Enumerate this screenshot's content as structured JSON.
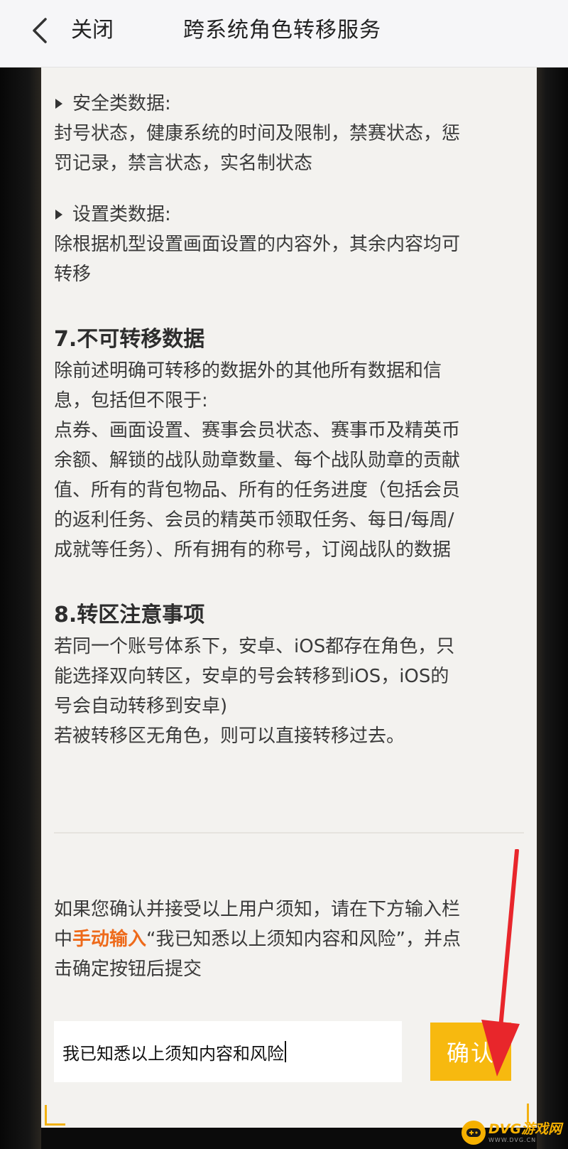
{
  "header": {
    "back_icon": "chevron-left-icon",
    "close_label": "关闭",
    "title": "跨系统角色转移服务"
  },
  "sections": {
    "security": {
      "heading": "安全类数据:",
      "line1": "封号状态，健康系统的时间及限制，禁赛状态，惩",
      "line2": "罚记录，禁言状态，实名制状态"
    },
    "settings": {
      "heading": "设置类数据:",
      "line1": "除根据机型设置画面设置的内容外，其余内容均可",
      "line2": "转移"
    },
    "non_transferable": {
      "title": "7.不可转移数据",
      "lines": [
        "除前述明确可转移的数据外的其他所有数据和信",
        "息，包括但不限于:",
        "点券、画面设置、赛事会员状态、赛事币及精英币",
        "余额、解锁的战队勋章数量、每个战队勋章的贡献",
        "值、所有的背包物品、所有的任务进度（包括会员",
        "的返利任务、会员的精英币领取任务、每日/每周/",
        "成就等任务）、所有拥有的称号，订阅战队的数据"
      ]
    },
    "notes": {
      "title": "8.转区注意事项",
      "lines": [
        "若同一个账号体系下，安卓、iOS都存在角色，只",
        "能选择双向转区，安卓的号会转移到iOS，iOS的",
        "号会自动转移到安卓)",
        "若被转移区无角色，则可以直接转移过去。"
      ]
    }
  },
  "notice": {
    "line1": "如果您确认并接受以上用户须知，请在下方输入栏",
    "line2_prefix": "中",
    "line2_highlight": "手动输入",
    "line2_suffix": "“我已知悉以上须知内容和风险”，并点",
    "line3": "击确定按钮后提交"
  },
  "input": {
    "value": "我已知悉以上须知内容和风险"
  },
  "confirm_button": {
    "label": "确认"
  },
  "watermark": {
    "text": "DVG游戏网",
    "sub": "WWW.DVG.CN"
  },
  "colors": {
    "accent_yellow": "#f7b90f",
    "highlight_orange": "#ee6a1a",
    "arrow_red": "#e8262b",
    "panel_bg": "#f3f2ef"
  }
}
